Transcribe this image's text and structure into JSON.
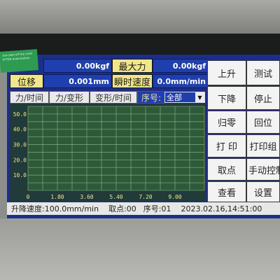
{
  "sticker_text": "Use peel off the mark AFTER examination",
  "readouts": {
    "force_value": "0.00kgf",
    "max_force_label": "最大力",
    "max_force_value": "0.00kgf",
    "displacement_label": "位移",
    "displacement_value": "0.001mm",
    "instant_speed_label": "瞬时速度",
    "instant_speed_value": "0.0mm/min"
  },
  "tabs": [
    {
      "label": "力/时间",
      "selected": false
    },
    {
      "label": "力/变形",
      "selected": false
    },
    {
      "label": "变形/时间",
      "selected": false
    }
  ],
  "serial": {
    "label": "序号:",
    "selected_value": "全部"
  },
  "chart_data": {
    "type": "line",
    "x_ticks": [
      "0",
      "1.80",
      "3.60",
      "5.40",
      "7.20",
      "9.00"
    ],
    "y_ticks": [
      "50.0",
      "40.0",
      "30.0",
      "20.0",
      "10.0"
    ],
    "xlim": [
      0,
      10.8
    ],
    "ylim": [
      0,
      55
    ],
    "grid": true,
    "series": [
      {
        "values": []
      }
    ]
  },
  "buttons": {
    "up": "上升",
    "test": "测试",
    "down": "下降",
    "stop": "停止",
    "zero": "归零",
    "return": "回位",
    "print": "打 印",
    "print_group": "打印组",
    "pick_point": "取点",
    "manual_control": "手动控制",
    "view": "查看",
    "settings": "设置"
  },
  "status": {
    "speed": "升降速度:100.0mm/min",
    "point": "取点:00",
    "serial_no": "序号:01",
    "datetime": "2023.02.16,14:51:00"
  },
  "colors": {
    "screen_bg": "#1e2e86",
    "value_bg": "#1f3fae",
    "label_bg": "#f0e68c",
    "chart_bg": "#213a3a",
    "grid": "#8fbf8f"
  }
}
